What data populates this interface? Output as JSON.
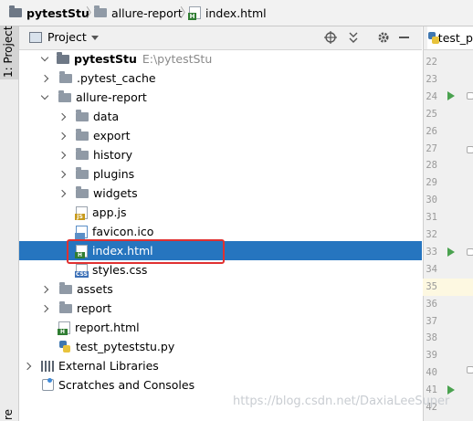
{
  "breadcrumb": {
    "items": [
      "pytestStu",
      "allure-report",
      "index.html"
    ]
  },
  "sidebar": {
    "tab_label": "1: Project",
    "bottom_label": "re"
  },
  "project_panel": {
    "title": "Project",
    "tree": [
      {
        "label": "pytestStu",
        "sub": "E:\\pytestStu",
        "icon": "folder-icon",
        "expanded": true
      },
      {
        "label": ".pytest_cache",
        "icon": "folder-icon",
        "expanded": false
      },
      {
        "label": "allure-report",
        "icon": "folder-icon",
        "expanded": true
      },
      {
        "label": "data",
        "icon": "folder-icon",
        "expanded": false
      },
      {
        "label": "export",
        "icon": "folder-icon",
        "expanded": false
      },
      {
        "label": "history",
        "icon": "folder-icon",
        "expanded": false
      },
      {
        "label": "plugins",
        "icon": "folder-icon",
        "expanded": false
      },
      {
        "label": "widgets",
        "icon": "folder-icon",
        "expanded": false
      },
      {
        "label": "app.js",
        "icon": "js-file-icon"
      },
      {
        "label": "favicon.ico",
        "icon": "ico-file-icon"
      },
      {
        "label": "index.html",
        "icon": "html-file-icon",
        "selected": true
      },
      {
        "label": "styles.css",
        "icon": "css-file-icon"
      },
      {
        "label": "assets",
        "icon": "folder-icon",
        "expanded": false
      },
      {
        "label": "report",
        "icon": "folder-icon",
        "expanded": false
      },
      {
        "label": "report.html",
        "icon": "html-file-icon"
      },
      {
        "label": "test_pyteststu.py",
        "icon": "python-file-icon"
      },
      {
        "label": "External Libraries",
        "icon": "library-icon",
        "expanded": false
      },
      {
        "label": "Scratches and Consoles",
        "icon": "scratches-icon"
      }
    ]
  },
  "editor": {
    "tab_label": "test_p",
    "line_numbers": [
      "22",
      "23",
      "24",
      "25",
      "26",
      "27",
      "28",
      "29",
      "30",
      "31",
      "32",
      "33",
      "34",
      "35",
      "36",
      "37",
      "38",
      "39",
      "40",
      "41",
      "42"
    ],
    "current_line": "35"
  },
  "watermark": "https://blog.csdn.net/DaxiaLeeSuper",
  "colors": {
    "selection": "#2675bf",
    "highlight_box": "#e03131",
    "run_icon": "#4aa24f"
  }
}
